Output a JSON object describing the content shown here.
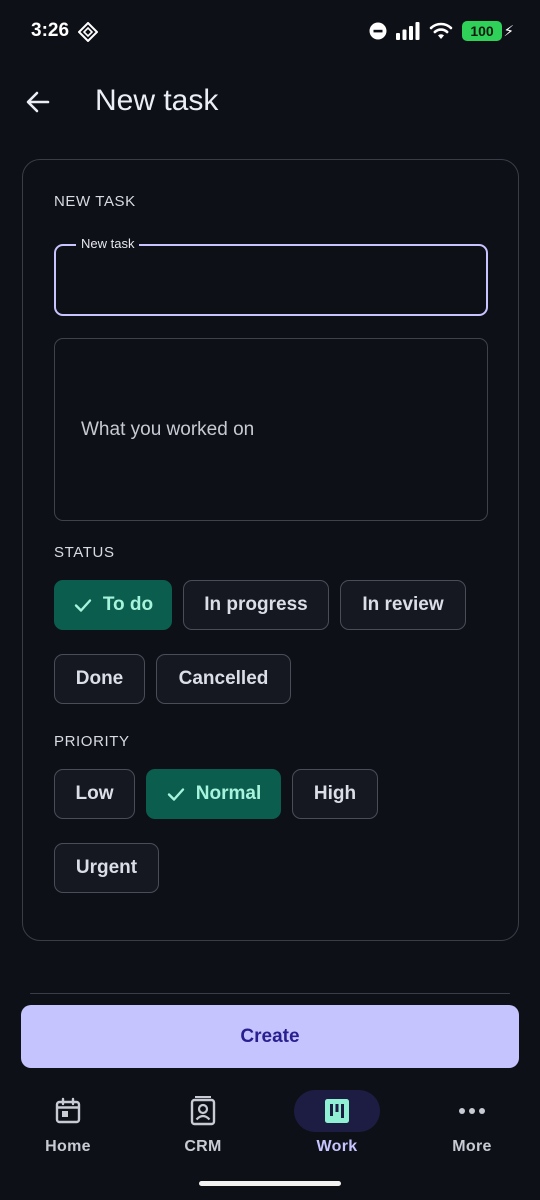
{
  "status_bar": {
    "time": "3:26",
    "battery": "100"
  },
  "header": {
    "title": "New task"
  },
  "form": {
    "section_label": "NEW TASK",
    "title_field": {
      "label": "New task",
      "value": ""
    },
    "description_field": {
      "placeholder": "What you worked on",
      "value": ""
    },
    "status": {
      "label": "STATUS",
      "options": [
        "To do",
        "In progress",
        "In review",
        "Done",
        "Cancelled"
      ],
      "selected": "To do"
    },
    "priority": {
      "label": "PRIORITY",
      "options": [
        "Low",
        "Normal",
        "High",
        "Urgent"
      ],
      "selected": "Normal"
    }
  },
  "actions": {
    "create_label": "Create"
  },
  "bottom_nav": {
    "items": [
      {
        "label": "Home",
        "icon": "calendar-icon"
      },
      {
        "label": "CRM",
        "icon": "contact-card-icon"
      },
      {
        "label": "Work",
        "icon": "kanban-board-icon"
      },
      {
        "label": "More",
        "icon": "more-dots-icon"
      }
    ],
    "active": "Work"
  },
  "colors": {
    "background": "#0e1017",
    "accent": "#c6c4ff",
    "selected_chip": "#0b5e4e",
    "selected_chip_text": "#a7f3dc",
    "battery": "#2fd159"
  }
}
